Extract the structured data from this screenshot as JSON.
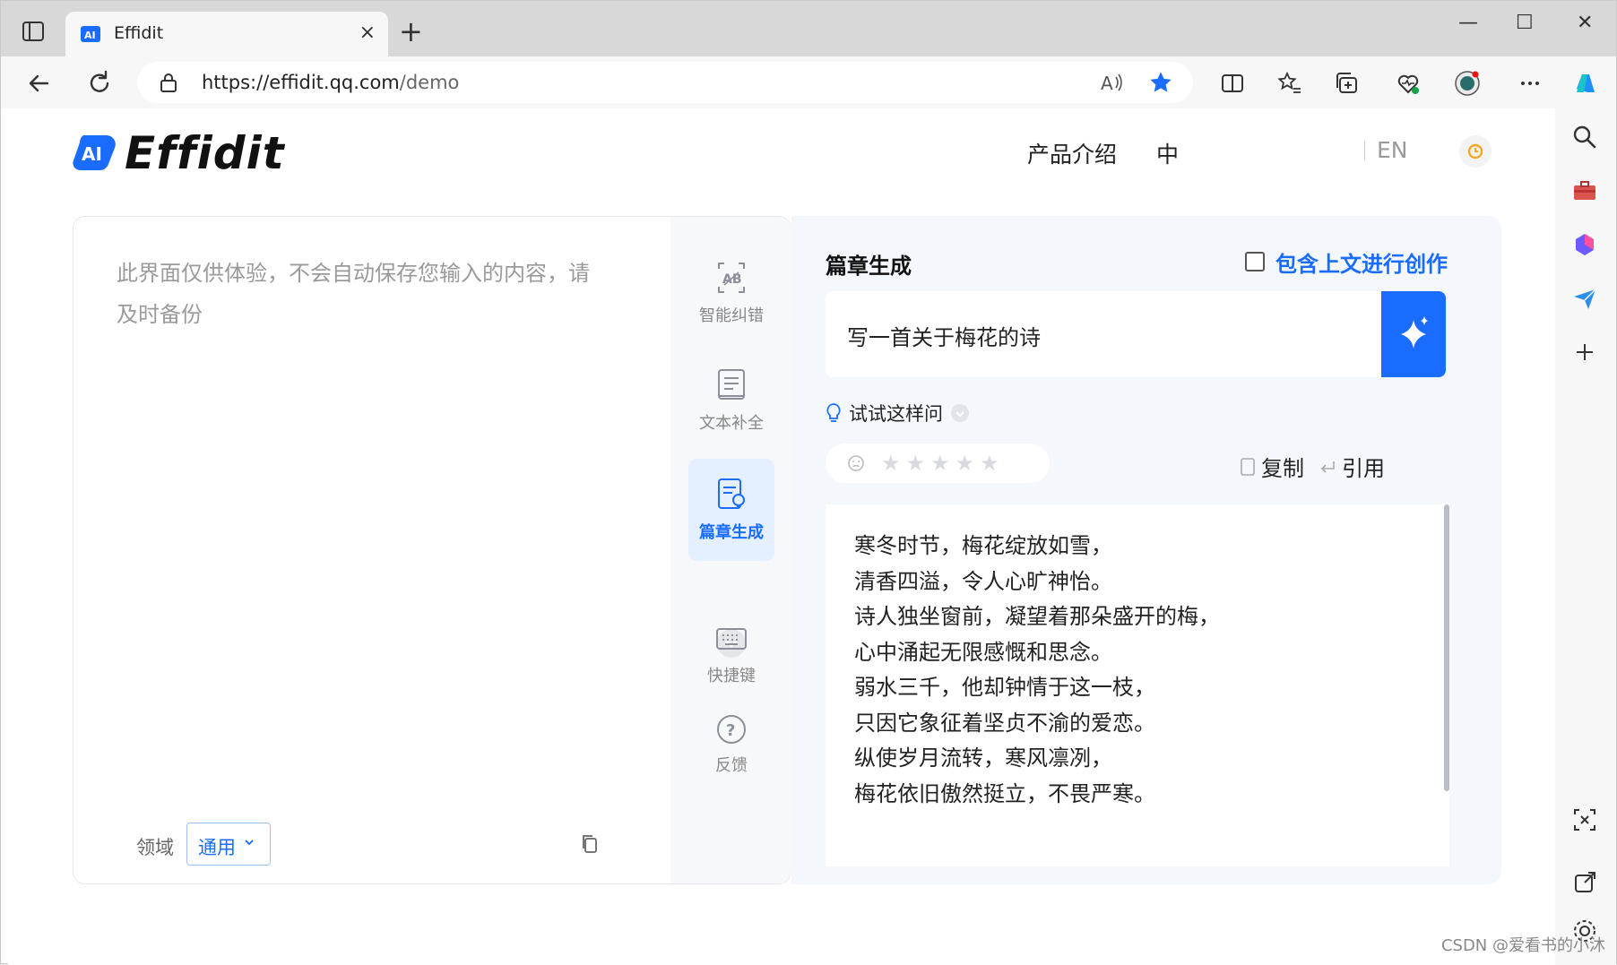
{
  "browser": {
    "tab_title": "Effidit",
    "url_host": "https://effidit.qq.com",
    "url_path": "/demo",
    "new_tab": "+",
    "close_tab": "×",
    "win_min": "—",
    "win_max": "☐",
    "win_close": "✕"
  },
  "header": {
    "logo_badge": "AI",
    "logo_text": "Effidit",
    "product_intro": "产品介绍",
    "lang_zh": "中",
    "lang_en": "EN"
  },
  "editor": {
    "placeholder": "此界面仅供体验，不会自动保存您输入的内容，请及时备份",
    "domain_label": "领域",
    "domain_value": "通用"
  },
  "tools": [
    {
      "label": "智能纠错",
      "icon": "ai-correct-icon",
      "active": false
    },
    {
      "label": "文本补全",
      "icon": "text-complete-icon",
      "active": false
    },
    {
      "label": "篇章生成",
      "icon": "article-generate-icon",
      "active": true
    },
    {
      "label": "快捷键",
      "icon": "keyboard-icon",
      "active": false
    },
    {
      "label": "反馈",
      "icon": "help-icon",
      "active": false
    }
  ],
  "panel": {
    "title": "篇章生成",
    "context_checkbox_label": "包含上文进行创作",
    "context_checked": false,
    "prompt": "写一首关于梅花的诗",
    "hint": "试试这样问",
    "rating_stars": 5,
    "rating_value": 0,
    "copy_label": "复制",
    "quote_label": "引用",
    "poem": [
      "寒冬时节，梅花绽放如雪，",
      "清香四溢，令人心旷神怡。",
      "诗人独坐窗前，凝望着那朵盛开的梅，",
      "心中涌起无限感慨和思念。",
      "弱水三千，他却钟情于这一枝，",
      "只因它象征着坚贞不渝的爱恋。",
      "纵使岁月流转，寒风凛冽，",
      "梅花依旧傲然挺立，不畏严寒。"
    ]
  },
  "watermark": "CSDN @爱看书的小沐",
  "colors": {
    "accent": "#1a6cff",
    "panel_bg": "#f4f7fc",
    "tab_strip": "#d8d8d8"
  }
}
